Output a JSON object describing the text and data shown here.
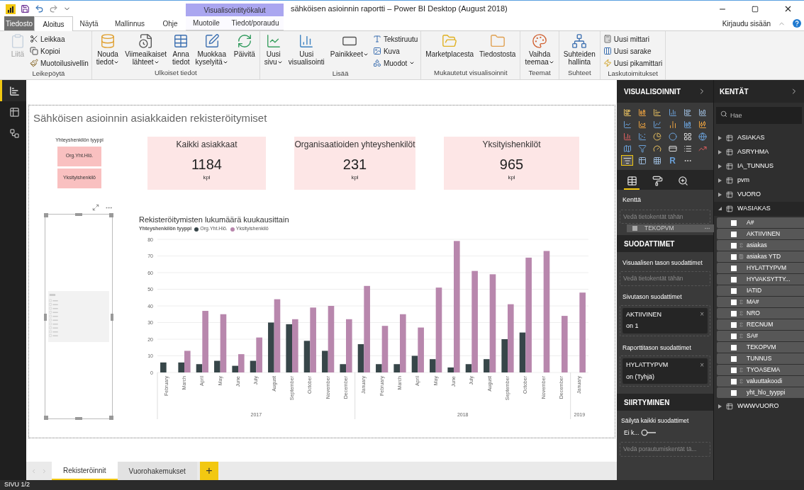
{
  "title_bar": {
    "context_header": "Visualisointityökalut",
    "title": "sähköisen asioinnin raportti – Power BI Desktop (August 2018)"
  },
  "tabs": [
    {
      "label": "Tiedosto",
      "kind": "file",
      "selected": false
    },
    {
      "label": "Aloitus",
      "kind": "normal",
      "selected": true
    },
    {
      "label": "Näytä",
      "kind": "normal",
      "selected": false
    },
    {
      "label": "Mallinnus",
      "kind": "normal",
      "selected": false
    },
    {
      "label": "Ohje",
      "kind": "normal",
      "selected": false
    },
    {
      "label": "Muotoile",
      "kind": "contextual",
      "selected": false
    },
    {
      "label": "Tiedot/poraudu",
      "kind": "contextual",
      "selected": false
    }
  ],
  "account": {
    "sign_in": "Kirjaudu sisään"
  },
  "ribbon": [
    {
      "label": "Leikepöytä",
      "buttons": [
        {
          "kind": "large",
          "lines": [
            "Liitä"
          ],
          "dropdown": false,
          "disabled": true
        },
        {
          "kind": "small",
          "lines": [
            "Leikkaa"
          ],
          "dropdown": false,
          "disabled": false
        },
        {
          "kind": "small",
          "lines": [
            "Kopioi"
          ],
          "dropdown": false,
          "disabled": false
        },
        {
          "kind": "small",
          "lines": [
            "Muotoilusivellin"
          ],
          "dropdown": false,
          "disabled": false
        }
      ]
    },
    {
      "label": "Ulkoiset tiedot",
      "buttons": [
        {
          "kind": "large",
          "lines": [
            "Nouda",
            "tiedot"
          ],
          "dropdown": true,
          "disabled": false
        },
        {
          "kind": "large",
          "lines": [
            "Viimeaikaiset",
            "lähteet"
          ],
          "dropdown": true,
          "disabled": false
        },
        {
          "kind": "large",
          "lines": [
            "Anna",
            "tiedot"
          ],
          "dropdown": false,
          "disabled": false
        },
        {
          "kind": "large",
          "lines": [
            "Muokkaa",
            "kyselyitä"
          ],
          "dropdown": true,
          "disabled": false
        },
        {
          "kind": "large",
          "lines": [
            "Päivitä"
          ],
          "dropdown": false,
          "disabled": false
        }
      ]
    },
    {
      "label": "Lisää",
      "buttons": [
        {
          "kind": "large",
          "lines": [
            "Uusi",
            "sivu"
          ],
          "dropdown": true,
          "disabled": false
        },
        {
          "kind": "large",
          "lines": [
            "Uusi",
            "visualisointi"
          ],
          "dropdown": false,
          "disabled": false
        },
        {
          "kind": "large",
          "lines": [
            "Painikkeet"
          ],
          "dropdown": true,
          "disabled": false
        },
        {
          "kind": "small",
          "lines": [
            "Tekstiruutu"
          ],
          "dropdown": false,
          "disabled": false
        },
        {
          "kind": "small",
          "lines": [
            "Kuva"
          ],
          "dropdown": false,
          "disabled": false
        },
        {
          "kind": "small",
          "lines": [
            "Muodot"
          ],
          "dropdown": true,
          "disabled": false
        }
      ]
    },
    {
      "label": "Mukautetut visualisoinnit",
      "buttons": [
        {
          "kind": "large",
          "lines": [
            "Marketplacesta"
          ],
          "dropdown": false,
          "disabled": false
        },
        {
          "kind": "large",
          "lines": [
            "Tiedostosta"
          ],
          "dropdown": false,
          "disabled": false
        }
      ]
    },
    {
      "label": "Teemat",
      "buttons": [
        {
          "kind": "large",
          "lines": [
            "Vaihda",
            "teemaa"
          ],
          "dropdown": true,
          "disabled": false
        }
      ]
    },
    {
      "label": "Suhteet",
      "buttons": [
        {
          "kind": "large",
          "lines": [
            "Suhteiden",
            "hallinta"
          ],
          "dropdown": false,
          "disabled": false
        }
      ]
    },
    {
      "label": "Laskutoimitukset",
      "buttons": [
        {
          "kind": "small",
          "lines": [
            "Uusi mittari"
          ],
          "dropdown": false,
          "disabled": false
        },
        {
          "kind": "small",
          "lines": [
            "Uusi sarake"
          ],
          "dropdown": false,
          "disabled": false
        },
        {
          "kind": "small",
          "lines": [
            "Uusi pikamittari"
          ],
          "dropdown": false,
          "disabled": false
        }
      ]
    }
  ],
  "views": [
    {
      "selected": true
    },
    {
      "selected": false
    },
    {
      "selected": false
    }
  ],
  "report": {
    "title": "Sähköisen asioinnin asiakkaiden rekisteröitymiset",
    "slicer": {
      "title": "Yhteyshenkilön tyyppi",
      "options": [
        "Org.Yht.Hlö.",
        "Yksityishenkilö"
      ]
    },
    "cards": [
      {
        "title": "Kaikki asiakkaat",
        "value": "1184",
        "unit": "kpl"
      },
      {
        "title": "Organisaatioiden yhteyshenkilöt",
        "value": "231",
        "unit": "kpl"
      },
      {
        "title": "Yksityishenkilöt",
        "value": "965",
        "unit": "kpl"
      }
    ],
    "chart": {
      "title": "Rekisteröitymisten lukumäärä kuukausittain",
      "legend_title": "Yhteyshenkilön tyyppi",
      "x_groups": [
        "2017",
        "2018",
        "2019"
      ],
      "chart_data": {
        "type": "bar",
        "categories": [
          "February",
          "March",
          "April",
          "May",
          "June",
          "July",
          "August",
          "September",
          "October",
          "November",
          "December",
          "January",
          "February",
          "March",
          "April",
          "May",
          "June",
          "July",
          "August",
          "September",
          "October",
          "November",
          "December",
          "January"
        ],
        "series": [
          {
            "name": "Org.Yht.Hlö.",
            "color": "#374649",
            "values": [
              6,
              6,
              5,
              7,
              4,
              7,
              30,
              29,
              19,
              13,
              5,
              17,
              5,
              5,
              10,
              8,
              3,
              5,
              8,
              20,
              24,
              null,
              null,
              null
            ]
          },
          {
            "name": "Yksityishenkilö",
            "color": "#b887ad",
            "values": [
              null,
              13,
              37,
              35,
              11,
              21,
              44,
              32,
              39,
              40,
              32,
              52,
              28,
              35,
              27,
              51,
              79,
              61,
              59,
              41,
              69,
              73,
              34,
              48
            ]
          }
        ],
        "ylim": [
          0,
          80
        ],
        "yticks": [
          0,
          10,
          20,
          30,
          40,
          50,
          60,
          70,
          80
        ],
        "grid": true,
        "legend": "top"
      }
    }
  },
  "pages": [
    {
      "label": "Rekisteröinnit",
      "selected": true
    },
    {
      "label": "Vuorohakemukset",
      "selected": false
    }
  ],
  "add_page": "+",
  "status_bar": "SIVU 1/2",
  "visualizations": {
    "title": "VISUALISOINNIT",
    "gallery": [
      {
        "selected": false
      },
      {
        "selected": false
      },
      {
        "selected": false
      },
      {
        "selected": false
      },
      {
        "selected": false
      },
      {
        "selected": false
      },
      {
        "selected": false
      },
      {
        "selected": false
      },
      {
        "selected": false
      },
      {
        "selected": false
      },
      {
        "selected": false
      },
      {
        "selected": false
      },
      {
        "selected": false
      },
      {
        "selected": false
      },
      {
        "selected": false
      },
      {
        "selected": false
      },
      {
        "selected": false
      },
      {
        "selected": false
      },
      {
        "selected": false
      },
      {
        "selected": false
      },
      {
        "selected": false
      },
      {
        "selected": false
      },
      {
        "selected": false
      },
      {
        "selected": false
      },
      {
        "selected": true
      },
      {
        "selected": false
      },
      {
        "selected": false
      },
      {
        "text": "R",
        "selected": false
      },
      {
        "selected": false
      }
    ],
    "pane_tabs": [
      {
        "selected": true
      },
      {
        "selected": false
      },
      {
        "selected": false
      }
    ],
    "field_label": "Kenttä",
    "field_drop": "Vedä tietokentät tähän",
    "dragged_field": "TEKOPVM",
    "filters_title": "SUODATTIMET",
    "visual_filters": "Visuaalisen tason suodattimet",
    "visual_drop": "Vedä tietokentät tähän",
    "page_filters": "Sivutason suodattimet",
    "page_filter_cards": [
      {
        "field": "AKTIIVINEN",
        "condition": "on 1",
        "close": "×"
      }
    ],
    "report_filters": "Raporttitason suodattimet",
    "report_filter_cards": [
      {
        "field": "HYLATTYPVM",
        "condition": "on (Tyhjä)",
        "close": "×"
      }
    ],
    "drillthrough_title": "SIIRTYMINEN",
    "keep_filters": "Säilytä kaikki suodattimet",
    "keep_toggle": {
      "label": "Ei k...",
      "on": false
    },
    "drill_drop": "Vedä porautumiskentät tä..."
  },
  "fields": {
    "title": "KENTÄT",
    "search_placeholder": "Hae",
    "tables": [
      {
        "name": "ASIAKAS",
        "expanded": false
      },
      {
        "name": "ASRYHMA",
        "expanded": false
      },
      {
        "name": "IA_TUNNUS",
        "expanded": false
      },
      {
        "name": "pvm",
        "expanded": false
      },
      {
        "name": "VUORO",
        "expanded": false
      },
      {
        "name": "WASIAKAS",
        "expanded": true,
        "children": [
          {
            "name": "A#",
            "kind": "column",
            "checked": false
          },
          {
            "name": "AKTIIVINEN",
            "kind": "column",
            "checked": false
          },
          {
            "name": "asiakas",
            "kind": "sum",
            "checked": false
          },
          {
            "name": "asiakas YTD",
            "kind": "measure",
            "checked": false
          },
          {
            "name": "HYLATTYPVM",
            "kind": "column",
            "checked": false
          },
          {
            "name": "HYVAKSYTTY...",
            "kind": "column",
            "checked": false
          },
          {
            "name": "IATID",
            "kind": "column",
            "checked": false
          },
          {
            "name": "MA#",
            "kind": "sum",
            "checked": false
          },
          {
            "name": "NRO",
            "kind": "sum",
            "checked": false
          },
          {
            "name": "RECNUM",
            "kind": "sum",
            "checked": false
          },
          {
            "name": "SA#",
            "kind": "sum",
            "checked": false
          },
          {
            "name": "TEKOPVM",
            "kind": "column",
            "checked": false
          },
          {
            "name": "TUNNUS",
            "kind": "column",
            "checked": false
          },
          {
            "name": "TYOASEMA",
            "kind": "sum",
            "checked": false
          },
          {
            "name": "valuuttakoodi",
            "kind": "sum",
            "checked": false
          },
          {
            "name": "yht_hlo_tyyppi",
            "kind": "column",
            "checked": false
          }
        ]
      },
      {
        "name": "WWWVUORO",
        "expanded": false
      }
    ]
  }
}
